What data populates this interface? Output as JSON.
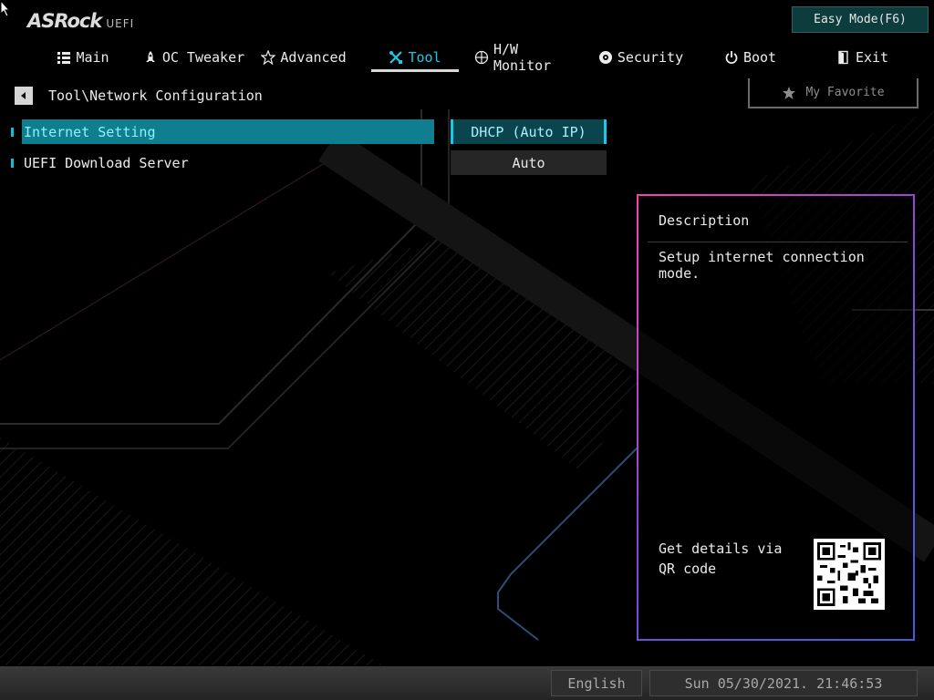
{
  "app": {
    "logo_text": "ASRock",
    "logo_suffix": "UEFI",
    "easy_mode_label": "Easy Mode(F6)"
  },
  "tabs": [
    {
      "label": "Main",
      "icon": "list-icon",
      "active": false
    },
    {
      "label": "OC Tweaker",
      "icon": "rocket-icon",
      "active": false
    },
    {
      "label": "Advanced",
      "icon": "star-icon",
      "active": false
    },
    {
      "label": "Tool",
      "icon": "tools-icon",
      "active": true
    },
    {
      "label": "H/W Monitor",
      "icon": "monitor-icon",
      "active": false
    },
    {
      "label": "Security",
      "icon": "shield-icon",
      "active": false
    },
    {
      "label": "Boot",
      "icon": "power-icon",
      "active": false
    },
    {
      "label": "Exit",
      "icon": "exit-icon",
      "active": false
    }
  ],
  "breadcrumb": "Tool\\Network Configuration",
  "favorite_label": "My Favorite",
  "settings": [
    {
      "label": "Internet Setting",
      "value": "DHCP (Auto IP)",
      "selected": true
    },
    {
      "label": "UEFI Download Server",
      "value": "Auto",
      "selected": false
    }
  ],
  "description": {
    "title": "Description",
    "text": "Setup internet connection mode.",
    "qr_text": "Get details via QR code"
  },
  "status": {
    "language": "English",
    "datetime": "Sun 05/30/2021. 21:46:53"
  },
  "colors": {
    "accent": "#19c9e6",
    "selected_row": "#0f7e8f",
    "panel_border_start": "#ff3fb4",
    "panel_border_end": "#3f5fd8"
  }
}
